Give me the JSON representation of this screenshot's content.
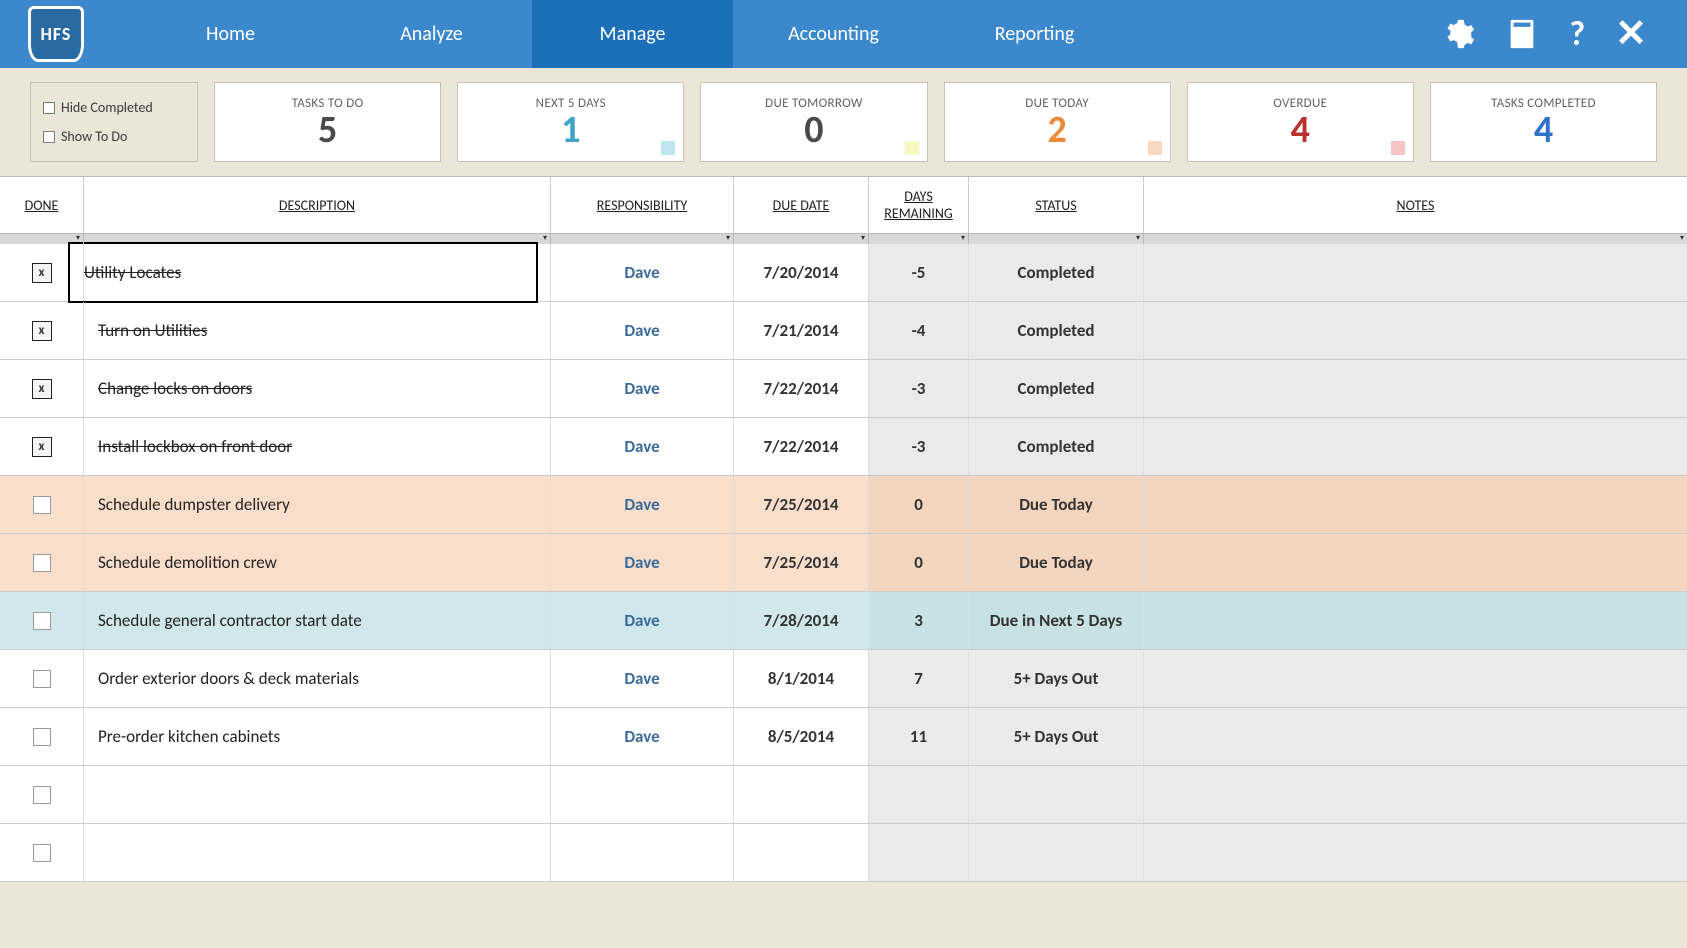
{
  "logo": "HFS",
  "nav": {
    "home": "Home",
    "analyze": "Analyze",
    "manage": "Manage",
    "accounting": "Accounting",
    "reporting": "Reporting"
  },
  "filters": {
    "hide_completed": "Hide Completed",
    "show_to_do": "Show To Do"
  },
  "stats": [
    {
      "label": "TASKS TO DO",
      "value": "5",
      "color": "#4a4a4a",
      "swatch": ""
    },
    {
      "label": "NEXT 5 DAYS",
      "value": "1",
      "color": "#3fa3c5",
      "swatch": "#bfe5ee"
    },
    {
      "label": "DUE TOMORROW",
      "value": "0",
      "color": "#4a4a4a",
      "swatch": "#fbf6c0"
    },
    {
      "label": "DUE TODAY",
      "value": "2",
      "color": "#e88b3a",
      "swatch": "#f8d8bf"
    },
    {
      "label": "OVERDUE",
      "value": "4",
      "color": "#b93230",
      "swatch": "#f3c5c5"
    },
    {
      "label": "TASKS COMPLETED",
      "value": "4",
      "color": "#2f72c9",
      "swatch": ""
    }
  ],
  "headers": {
    "done": "DONE",
    "description": "DESCRIPTION",
    "responsibility": "RESPONSIBILITY",
    "due_date": "DUE DATE",
    "days_remaining": "DAYS\nREMAINING",
    "status": "STATUS",
    "notes": "NOTES"
  },
  "rows": [
    {
      "done": true,
      "selected": true,
      "description": "Utility Locates",
      "responsibility": "Dave",
      "due_date": "7/20/2014",
      "days_remaining": "-5",
      "status": "Completed",
      "status_class": "completed"
    },
    {
      "done": true,
      "selected": false,
      "description": "Turn on Utilities",
      "responsibility": "Dave",
      "due_date": "7/21/2014",
      "days_remaining": "-4",
      "status": "Completed",
      "status_class": "completed"
    },
    {
      "done": true,
      "selected": false,
      "description": "Change locks on doors",
      "responsibility": "Dave",
      "due_date": "7/22/2014",
      "days_remaining": "-3",
      "status": "Completed",
      "status_class": "completed"
    },
    {
      "done": true,
      "selected": false,
      "description": "Install lockbox on front door",
      "responsibility": "Dave",
      "due_date": "7/22/2014",
      "days_remaining": "-3",
      "status": "Completed",
      "status_class": "completed"
    },
    {
      "done": false,
      "selected": false,
      "description": "Schedule dumpster delivery",
      "responsibility": "Dave",
      "due_date": "7/25/2014",
      "days_remaining": "0",
      "status": "Due Today",
      "status_class": "due-today"
    },
    {
      "done": false,
      "selected": false,
      "description": "Schedule demolition crew",
      "responsibility": "Dave",
      "due_date": "7/25/2014",
      "days_remaining": "0",
      "status": "Due Today",
      "status_class": "due-today"
    },
    {
      "done": false,
      "selected": false,
      "description": "Schedule general contractor start date",
      "responsibility": "Dave",
      "due_date": "7/28/2014",
      "days_remaining": "3",
      "status": "Due in Next 5 Days",
      "status_class": "next5"
    },
    {
      "done": false,
      "selected": false,
      "description": "Order exterior doors & deck materials",
      "responsibility": "Dave",
      "due_date": "8/1/2014",
      "days_remaining": "7",
      "status": "5+ Days Out",
      "status_class": "5plus"
    },
    {
      "done": false,
      "selected": false,
      "description": "Pre-order kitchen cabinets",
      "responsibility": "Dave",
      "due_date": "8/5/2014",
      "days_remaining": "11",
      "status": "5+ Days Out",
      "status_class": "5plus"
    },
    {
      "done": false,
      "selected": false,
      "description": "",
      "responsibility": "",
      "due_date": "",
      "days_remaining": "",
      "status": "",
      "status_class": "empty"
    },
    {
      "done": false,
      "selected": false,
      "description": "",
      "responsibility": "",
      "due_date": "",
      "days_remaining": "",
      "status": "",
      "status_class": "empty"
    }
  ]
}
